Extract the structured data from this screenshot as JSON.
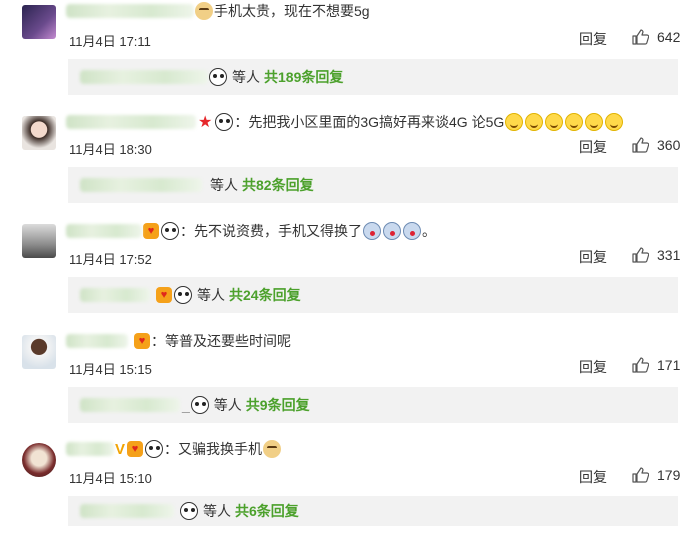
{
  "comments": [
    {
      "text": "手机太贵，现在不想要5g",
      "date": "11月4日 17:11",
      "reply_label": "回复",
      "likes": "642",
      "replies_people": "等人",
      "replies_count": "共189条回复"
    },
    {
      "text": "：先把我小区里面的3G搞好再来谈4G 论5G",
      "date": "11月4日 18:30",
      "reply_label": "回复",
      "likes": "360",
      "replies_people": "等人",
      "replies_count": "共82条回复"
    },
    {
      "text": "：先不说资费，手机又得换了",
      "text_tail": "。",
      "date": "11月4日 17:52",
      "reply_label": "回复",
      "likes": "331",
      "replies_people": "等人",
      "replies_count": "共24条回复"
    },
    {
      "text": "：等普及还要些时间呢",
      "date": "11月4日 15:15",
      "reply_label": "回复",
      "likes": "171",
      "replies_sep": "_",
      "replies_people": "等人",
      "replies_count": "共9条回复"
    },
    {
      "text": "：又骗我换手机",
      "date": "11月4日 15:10",
      "reply_label": "回复",
      "likes": "179",
      "replies_people": "等人",
      "replies_count": "共6条回复"
    }
  ],
  "colors": {
    "accent_green": "#4ca12c",
    "reply_bg": "#f2f2f2",
    "badge_red": "#e6272b",
    "badge_orange": "#f5a11a"
  },
  "icons": [
    "doge-emoji",
    "panda-emoji",
    "smile-emoji",
    "shock-emoji",
    "heart-badge",
    "star-badge",
    "v-badge",
    "thumbs-up-icon"
  ]
}
